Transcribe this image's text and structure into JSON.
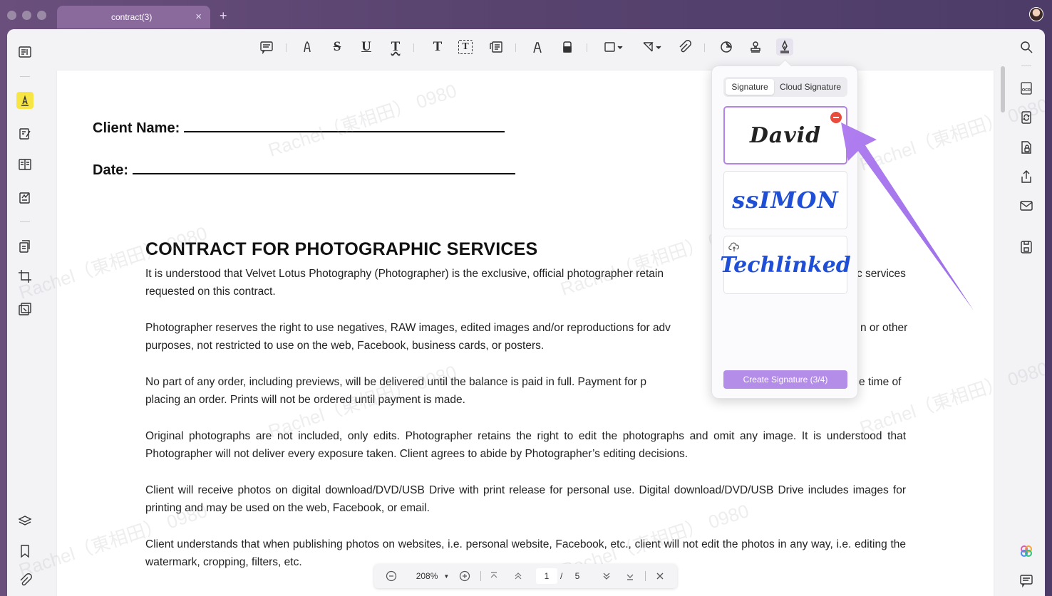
{
  "tab": {
    "title": "contract(3)",
    "close": "×",
    "new_tab": "+"
  },
  "toolbar": {
    "strike": "S",
    "underline": "U",
    "squiggly": "T",
    "text": "T",
    "textbox": "T"
  },
  "document": {
    "client_name_label": "Client Name:",
    "date_label": "Date:",
    "heading": "CONTRACT FOR PHOTOGRAPHIC SERVICES",
    "paragraphs": [
      "It is understood that Velvet Lotus Photography (Photographer) is the exclusive, official photographer retain",
      "c services",
      "requested on this contract.",
      "Photographer reserves the right to use negatives, RAW images, edited images and/or reproductions for adv",
      "n or other",
      "purposes, not restricted to use on the web, Facebook, business cards, or posters.",
      "No part of any order, including previews, will be delivered until the balance is paid in full. Payment for p",
      "e time of",
      "placing an order. Prints will not be ordered until payment is made.",
      "Original photographs are not included, only edits. Photographer retains the right to edit the photographs and omit any image. It is understood that Photographer will not deliver every exposure taken. Client agrees to abide by Photographer’s editing decisions.",
      "Client will receive photos on digital download/DVD/USB Drive with print release for personal use. Digital download/DVD/USB Drive includes images for printing and may be used on the web, Facebook, or email.",
      "Client understands that when publishing photos on websites, i.e. personal website, Facebook, etc., client will not edit the photos in any way, i.e. editing the watermark, cropping, filters, etc."
    ],
    "watermark": "Rachel（東相田） 0980"
  },
  "signature_panel": {
    "tab_signature": "Signature",
    "tab_cloud": "Cloud Signature",
    "signatures": [
      "David",
      "ssIMON",
      "Techlinked"
    ],
    "create_button": "Create Signature (3/4)",
    "accent_color": "#b48de9",
    "signature_ink_dark": "#222222",
    "signature_ink_blue": "#1f4fd6"
  },
  "pagebar": {
    "zoom": "208%",
    "current_page": "1",
    "separator": "/",
    "total_pages": "5"
  }
}
